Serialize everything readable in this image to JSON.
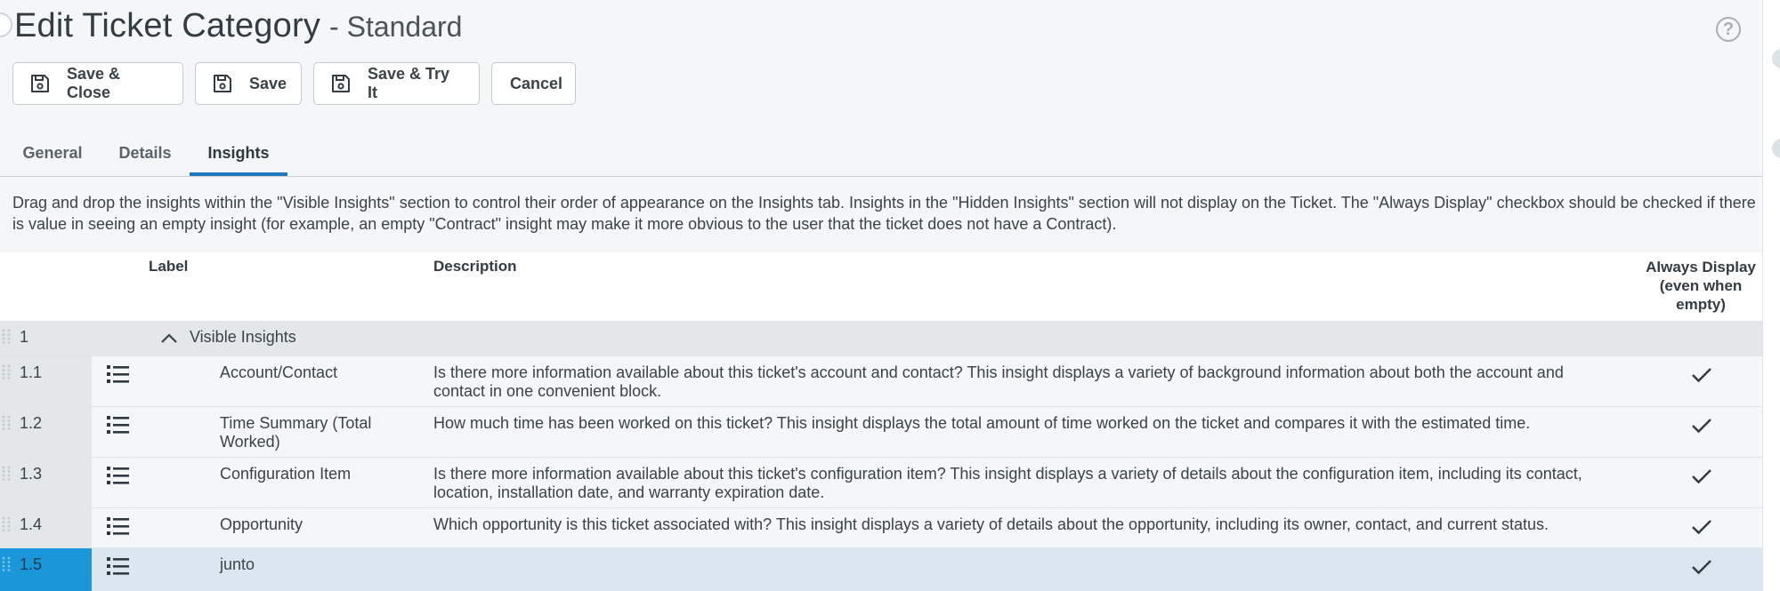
{
  "header": {
    "title": "Edit Ticket Category",
    "subtitle": "- Standard",
    "help_glyph": "?"
  },
  "toolbar": {
    "save_close": "Save & Close",
    "save": "Save",
    "save_try": "Save & Try It",
    "cancel": "Cancel"
  },
  "tabs": [
    {
      "label": "General",
      "active": false
    },
    {
      "label": "Details",
      "active": false
    },
    {
      "label": "Insights",
      "active": true
    }
  ],
  "instructions": "Drag and drop the insights within the \"Visible Insights\" section to control their order of appearance on the Insights tab. Insights in the \"Hidden Insights\" section will not display on the Ticket. The \"Always Display\" checkbox should be checked if there is value in seeing an empty insight (for example, an empty \"Contract\" insight may make it more obvious to the user that the ticket does not have a Contract).",
  "grid": {
    "columns": {
      "label": "Label",
      "description": "Description",
      "always": "Always Display (even when empty)"
    },
    "group": {
      "num": "1",
      "label": "Visible Insights",
      "expanded": true
    },
    "rows": [
      {
        "num": "1.1",
        "label": "Account/Contact",
        "description": "Is there more information available about this ticket's account and contact? This insight displays a variety of background information about both the account and contact in one convenient block.",
        "always": true
      },
      {
        "num": "1.2",
        "label": "Time Summary (Total Worked)",
        "description": "How much time has been worked on this ticket? This insight displays the total amount of time worked on the ticket and compares it with the estimated time.",
        "always": true
      },
      {
        "num": "1.3",
        "label": "Configuration Item",
        "description": "Is there more information available about this ticket's configuration item? This insight displays a variety of details about the configuration item, including its contact, location, installation date, and warranty expiration date.",
        "always": true
      },
      {
        "num": "1.4",
        "label": "Opportunity",
        "description": "Which opportunity is this ticket associated with? This insight displays a variety of details about the opportunity, including its owner, contact, and current status.",
        "always": true
      },
      {
        "num": "1.5",
        "label": "junto",
        "description": "",
        "always": true,
        "selected": true
      }
    ]
  },
  "icons": {
    "save": "floppy-disk-icon",
    "help": "question-circle-icon",
    "drag": "drag-grip-icon",
    "list": "list-icon",
    "check": "checkmark-icon",
    "collapse": "chevron-up-icon"
  },
  "colors": {
    "accent": "#1f78bd",
    "selected_row": "#dce6f0",
    "selected_num_cell": "#1a97d9"
  }
}
